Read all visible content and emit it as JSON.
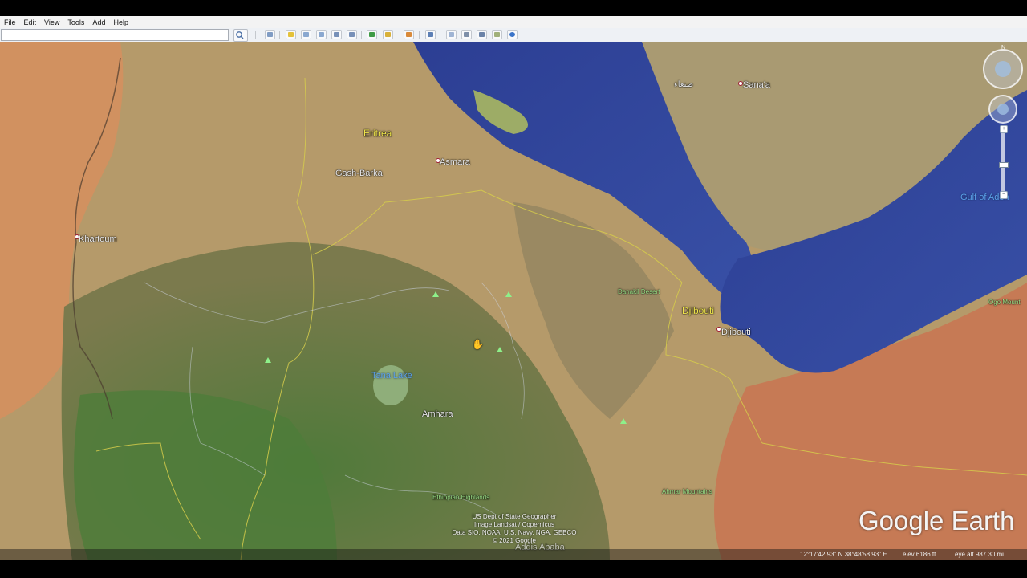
{
  "menubar": {
    "items": [
      "File",
      "Edit",
      "View",
      "Tools",
      "Add",
      "Help"
    ]
  },
  "search": {
    "value": "",
    "placeholder": ""
  },
  "toolbar": {
    "icons": [
      "sidebar-toggle-icon",
      "placemark-icon",
      "polygon-icon",
      "path-icon",
      "image-overlay-icon",
      "record-tour-icon",
      "historical-imagery-icon",
      "sunlight-icon",
      "planets-icon",
      "ruler-icon",
      "email-icon",
      "print-icon",
      "save-image-icon",
      "view-in-maps-icon",
      "earth-gallery-icon"
    ]
  },
  "map": {
    "labels": {
      "eritrea": "Eritrea",
      "asmara": "Asmara",
      "gash_barka": "Gash-Barka",
      "sanaa": "Sana'a",
      "sanaa_arabic": "صنعاء",
      "khartoum": "Khartoum",
      "gulf_of_aden": "Gulf of Aden",
      "danakil": "Danakil Desert",
      "djibouti_country": "Djibouti",
      "djibouti_city": "Djibouti",
      "tana_lake": "Tana Lake",
      "amhara": "Amhara",
      "ethiopian_highlands": "Ethiopian Highlands",
      "ahmar_mountains": "Ahmar Mountains",
      "addis_ababa": "Addis Ababa",
      "ogo_mountains": "Ogo Mount"
    },
    "attribution": [
      "US Dept of State Geographer",
      "Image Landsat / Copernicus",
      "Data SIO, NOAA, U.S. Navy, NGA, GEBCO",
      "© 2021 Google"
    ],
    "brand": "Google Earth"
  },
  "statusbar": {
    "coords": "12°17'42.93\" N   38°48'58.93\" E",
    "elevation": "elev  6186 ft",
    "eye_alt": "eye alt 987.30 mi"
  },
  "nav": {
    "north": "N",
    "zoom_in": "+",
    "zoom_out": "−"
  }
}
